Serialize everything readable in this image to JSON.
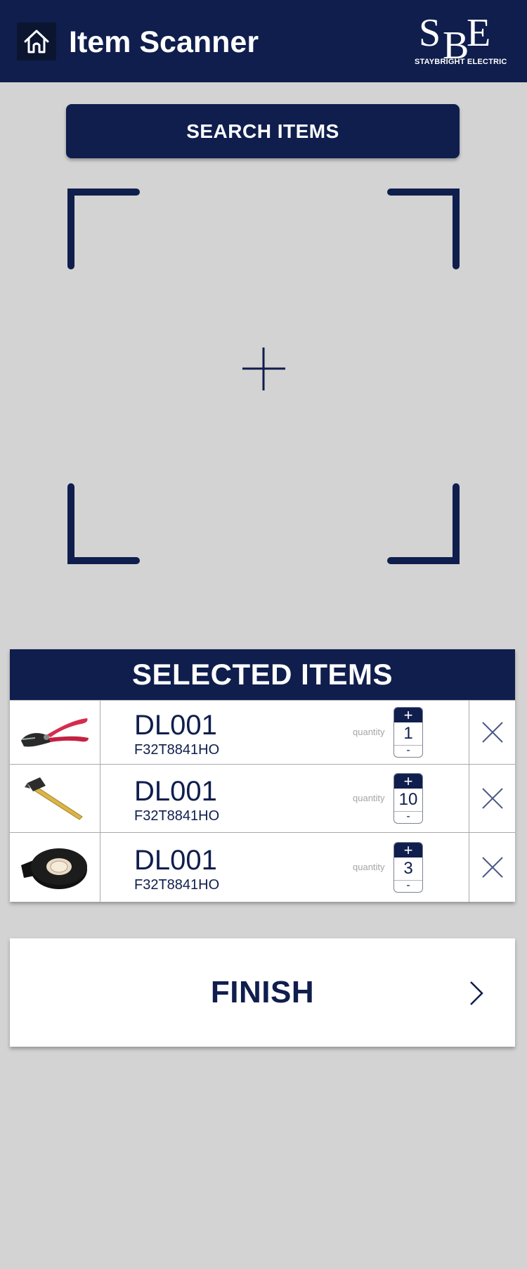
{
  "header": {
    "title": "Item Scanner",
    "home_icon": "home-icon",
    "logo_letters": [
      "S",
      "B",
      "E"
    ],
    "logo_subtitle": "STAYBRIGHT ELECTRIC"
  },
  "search": {
    "label": "SEARCH ITEMS"
  },
  "scanner": {
    "crosshair_icon": "crosshair-icon"
  },
  "selected": {
    "title": "SELECTED ITEMS",
    "quantity_label": "quantity",
    "plus": "+",
    "minus": "-",
    "items": [
      {
        "code": "DL001",
        "part": "F32T8841HO",
        "quantity": "1",
        "image": "wire-cutter-icon"
      },
      {
        "code": "DL001",
        "part": "F32T8841HO",
        "quantity": "10",
        "image": "hammer-icon"
      },
      {
        "code": "DL001",
        "part": "F32T8841HO",
        "quantity": "3",
        "image": "electrical-tape-icon"
      }
    ]
  },
  "finish": {
    "label": "FINISH",
    "icon": "chevron-right-icon"
  },
  "colors": {
    "navy": "#0f1e4d",
    "background": "#d3d3d3",
    "white": "#ffffff"
  }
}
